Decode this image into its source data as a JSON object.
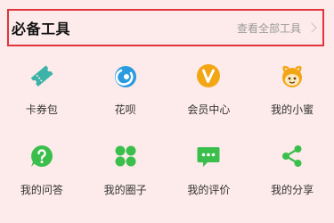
{
  "header": {
    "title": "必备工具",
    "link_label": "查看全部工具"
  },
  "tools": [
    {
      "label": "卡券包",
      "icon": "ticket-icon",
      "color": "#3bb3a8"
    },
    {
      "label": "花呗",
      "icon": "huabei-icon",
      "color": "#2a9be0"
    },
    {
      "label": "会员中心",
      "icon": "vip-icon",
      "color": "#f3a614"
    },
    {
      "label": "我的小蜜",
      "icon": "assistant-icon",
      "color": "#f3a614"
    },
    {
      "label": "我的问答",
      "icon": "question-icon",
      "color": "#3bbf4c"
    },
    {
      "label": "我的圈子",
      "icon": "circles-icon",
      "color": "#3bbf4c"
    },
    {
      "label": "我的评价",
      "icon": "comment-icon",
      "color": "#3bbf4c"
    },
    {
      "label": "我的分享",
      "icon": "share-icon",
      "color": "#3bbf4c"
    }
  ]
}
